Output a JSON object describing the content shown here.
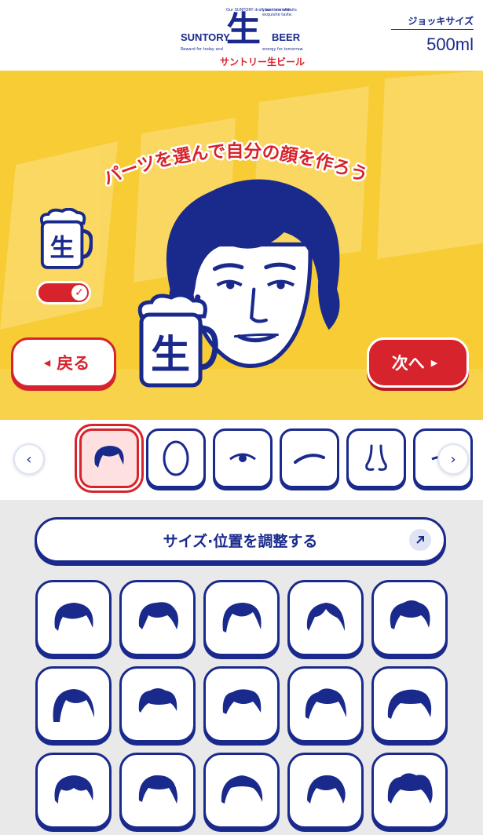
{
  "header": {
    "logo": {
      "brand_left": "SUNTORY",
      "brand_right": "BEER",
      "kanji": "生",
      "tagline_jp": "サントリー生ビール",
      "fine_1": "Our SUNTORY draft beer enriches",
      "fine_2": "your time with its exquisite taste.",
      "fine_3": "Reward for today and",
      "fine_4": "energy for tomorrow."
    },
    "size_label": "ジョッキサイズ",
    "size_value": "500ml"
  },
  "stage": {
    "headline": "パーツを選んで自分の顔を作ろう!",
    "mug_kanji": "生",
    "toggle_on": true,
    "back_label": "戻る",
    "next_label": "次へ"
  },
  "tabs": {
    "items": [
      {
        "icon": "hair-icon",
        "active": true
      },
      {
        "icon": "face-outline-icon",
        "active": false
      },
      {
        "icon": "eye-icon",
        "active": false
      },
      {
        "icon": "eyebrow-icon",
        "active": false
      },
      {
        "icon": "nose-icon",
        "active": false
      },
      {
        "icon": "mouth-icon",
        "active": false
      }
    ]
  },
  "panel": {
    "adjust_label": "サイズ·位置を調整する",
    "hair_options": [
      "hair-style-1-icon",
      "hair-style-2-icon",
      "hair-style-3-icon",
      "hair-style-4-icon",
      "hair-style-5-icon",
      "hair-style-6-icon",
      "hair-style-7-icon",
      "hair-style-8-icon",
      "hair-style-9-icon",
      "hair-style-10-icon",
      "hair-style-11-icon",
      "hair-style-12-icon",
      "hair-style-13-icon",
      "hair-style-14-icon",
      "hair-style-15-icon"
    ]
  },
  "colors": {
    "navy": "#1a2a8c",
    "red": "#d7232b",
    "yellow": "#f7cc35"
  }
}
